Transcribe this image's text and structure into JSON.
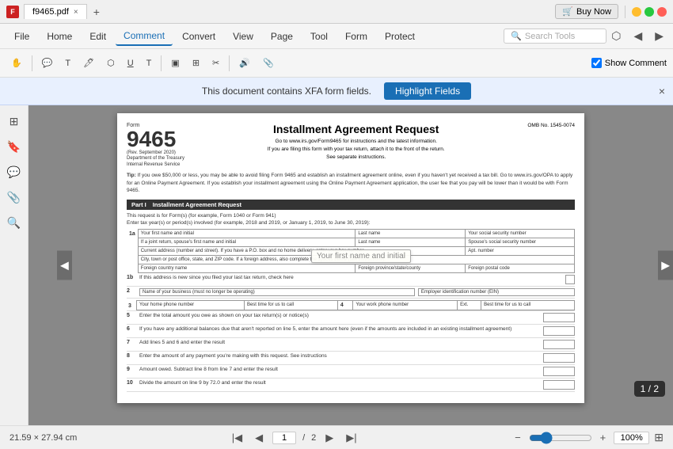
{
  "titleBar": {
    "appIcon": "F",
    "filename": "f9465.pdf",
    "tabClose": "×",
    "tabNew": "+",
    "buyNow": "Buy Now",
    "minBtn": "−",
    "maxBtn": "□",
    "closeBtn": "×"
  },
  "menuBar": {
    "items": [
      "File",
      "Home",
      "Edit",
      "Comment",
      "Convert",
      "View",
      "Page",
      "Tool",
      "Form",
      "Protect"
    ],
    "activeItem": "Comment",
    "searchPlaceholder": "Search Tools",
    "rightIcons": [
      "share",
      "back",
      "forward"
    ]
  },
  "toolbar": {
    "showComment": "Show Comment"
  },
  "xfaBanner": {
    "message": "This document contains XFA form fields.",
    "highlightBtn": "Highlight Fields",
    "closeBtn": "×"
  },
  "document": {
    "formLabel": "Form",
    "formNumber": "9465",
    "formRev": "(Rev. September 2020)",
    "dept1": "Department of the Treasury",
    "dept2": "Internal Revenue Service",
    "mainTitle": "Installment Agreement Request",
    "subtitle1": "Go to www.irs.gov/Form9465 for instructions and the latest information.",
    "subtitle2": "If you are filing this form with your tax return, attach it to the front of the return.",
    "subtitle3": "See separate instructions.",
    "omb": "OMB No. 1545-0074",
    "tipTitle": "Tip:",
    "tipText": "If you owe $50,000 or less, you may be able to avoid filing Form 9465 and establish an installment agreement online, even if you haven't yet received a tax bill. Go to www.irs.gov/OPA to apply for an Online Payment Agreement. If you establish your installment agreement using the Online Payment Agreement application, the user fee that you pay will be lower than it would be with Form 9465.",
    "partI": "Part I",
    "partITitle": "Installment Agreement Request",
    "requestLine": "This request is for Form(s) (for example, Form 1040 or Form 941)",
    "taxYearLine": "Enter tax year(s) or period(s) involved (for example, 2018 and 2019, or January 1, 2019, to June 30, 2019):",
    "field1a": "1a",
    "yourFirstName": "Your first name and initial",
    "lastName": "Last name",
    "ssn": "Your social security number",
    "jointSpouse": "If a joint return, spouse's first name and initial",
    "spouseLastName": "Last name",
    "spouseSSN": "Spouse's social security number",
    "currentAddress": "Current address (number and street). If you have a P.O. box and no home delivery, enter your box number.",
    "aptNumber": "Apt. number",
    "cityTown": "City, town or post office, state, and ZIP code. If a foreign address, also complete the spaces below (see instructions).",
    "foreignCountry": "Foreign country name",
    "foreignProvince": "Foreign province/state/county",
    "foreignPostal": "Foreign postal code",
    "field1b": "1b",
    "newAddress": "If this address is new since you filed your last tax return, check here",
    "field2": "2",
    "businessName": "Name of your business (must no longer be operating)",
    "employerID": "Employer identification number (EIN)",
    "field3": "3",
    "field4": "4",
    "homePhone": "Your home phone number",
    "bestTimeCall": "Best time for us to call",
    "workPhone": "Your work phone number",
    "ext": "Ext.",
    "bestTimeCallWork": "Best time for us to call",
    "field5": "5",
    "field5text": "Enter the total amount you owe as shown on your tax return(s) or notice(s)",
    "field6": "6",
    "field6text": "If you have any additional balances due that aren't reported on line 5, enter the amount here (even if the amounts are included in an existing installment agreement)",
    "field7": "7",
    "field7text": "Add lines 5 and 6 and enter the result",
    "field8": "8",
    "field8text": "Enter the amount of any payment you're making with this request. See instructions",
    "field9": "9",
    "field9text": "Amount owed. Subtract line 8 from line 7 and enter the result",
    "field10": "10",
    "field10text": "Divide the amount on line 9 by 72.0 and enter the result",
    "tooltipText": "Your first name and initial"
  },
  "statusBar": {
    "dimensions": "21.59 × 27.94 cm",
    "page": "1",
    "pageTotal": "2",
    "pageDisplay": "1 / 2",
    "zoom": "100%"
  },
  "pageCountBadge": "1 / 2"
}
